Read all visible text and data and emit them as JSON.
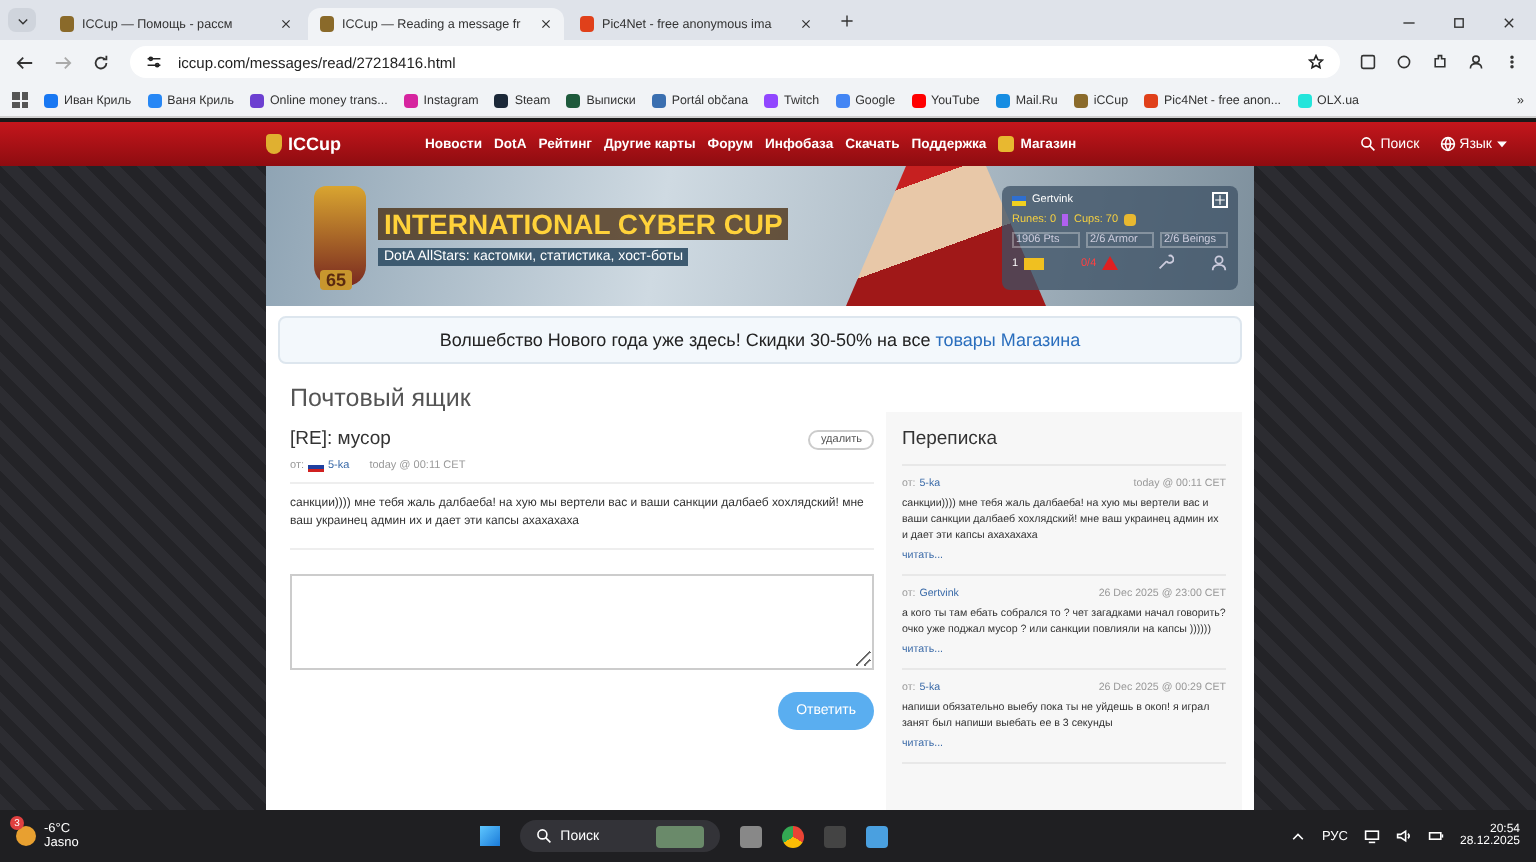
{
  "browser": {
    "tabs": [
      {
        "title": "ICCup — Помощь - рассм",
        "color": "#8a6a2a",
        "selected": false
      },
      {
        "title": "ICCup — Reading a message fr",
        "color": "#8a6a2a",
        "selected": true
      },
      {
        "title": "Pic4Net - free anonymous ima",
        "color": "#e0401a",
        "selected": false
      }
    ],
    "address": "iccup.com/messages/read/27218416.html",
    "bookmarks": [
      {
        "label": "Иван Криль",
        "color": "#1877f2"
      },
      {
        "label": "Ваня Криль",
        "color": "#2787f5"
      },
      {
        "label": "Online money trans...",
        "color": "#6c3fd1"
      },
      {
        "label": "Instagram",
        "color": "#d6249f"
      },
      {
        "label": "Steam",
        "color": "#1b2838"
      },
      {
        "label": "Выписки",
        "color": "#1e5a3c"
      },
      {
        "label": "Portál občana",
        "color": "#3a6fb0"
      },
      {
        "label": "Twitch",
        "color": "#9146ff"
      },
      {
        "label": "Google",
        "color": "#4285f4"
      },
      {
        "label": "YouTube",
        "color": "#ff0000"
      },
      {
        "label": "Mail.Ru",
        "color": "#168de2"
      },
      {
        "label": "iCCup",
        "color": "#8a6a2a"
      },
      {
        "label": "Pic4Net - free anon...",
        "color": "#e0401a"
      },
      {
        "label": "OLX.ua",
        "color": "#23e5db"
      }
    ],
    "more": "»"
  },
  "site": {
    "logo": "ICCup",
    "nav": [
      {
        "label": "Новости",
        "kind": "link"
      },
      {
        "label": "DotA",
        "kind": "link"
      },
      {
        "label": "Рейтинг",
        "kind": "link"
      },
      {
        "label": "Другие карты",
        "kind": "link"
      },
      {
        "label": "Форум",
        "kind": "link"
      },
      {
        "label": "Инфобаза",
        "kind": "link"
      },
      {
        "label": "Скачать",
        "kind": "link"
      },
      {
        "label": "Поддержка",
        "kind": "link"
      },
      {
        "label": "Магазин",
        "kind": "shop"
      }
    ],
    "search": "Поиск",
    "language": "Язык"
  },
  "banner": {
    "title": "INTERNATIONAL CYBER CUP",
    "subtitle": "DotA AllStars: кастомки, статистика, хост-боты",
    "badge": "65"
  },
  "user_panel": {
    "name": "Gertvink",
    "runes": "Runes: 0",
    "cups": "Cups: 70",
    "stats": [
      "1906 Pts",
      "2/6 Armor",
      "2/6 Beings"
    ],
    "mail_count": "1",
    "warnings": "0/4"
  },
  "promo": {
    "text": "Волшебство Нового года уже здесь! Скидки 30-50% на все",
    "link": "товары Магазина"
  },
  "mailbox": {
    "heading": "Почтовый ящик",
    "subject": "[RE]: мусор",
    "delete": "удалить",
    "from_label": "от:",
    "sender": "5-ka",
    "time": "today @ 00:11 CET",
    "body": "санкции)))) мне тебя жаль далбаеба! на хую мы вертели вас и ваши санкции далбаеб хохлядский! мне ваш украинец админ их и дает эти капсы ахахахаха",
    "reply_button": "Ответить"
  },
  "conversation": {
    "heading": "Переписка",
    "messages": [
      {
        "from_label": "от:",
        "sender": "5-ka",
        "time": "today @ 00:11 CET",
        "body": "санкции)))) мне тебя жаль далбаеба! на хую мы вертели вас и ваши санкции далбаеб хохлядский! мне ваш украинец админ их и дает эти капсы ахахахаха",
        "read_more": "читать..."
      },
      {
        "from_label": "от:",
        "sender": "Gertvink",
        "time": "26 Dec 2025 @ 23:00 CET",
        "body": "а кого ты там ебать собрался то ? чет загадками начал говорить? очко уже поджал мусор ? или санкции повлияли на капсы ))))))",
        "read_more": "читать..."
      },
      {
        "from_label": "от:",
        "sender": "5-ka",
        "time": "26 Dec 2025 @ 00:29 CET",
        "body": "напиши обязательно выебу пока ты не уйдешь в окоп! я играл занят был напиши выебать ее в 3 секунды",
        "read_more": "читать..."
      }
    ]
  },
  "taskbar": {
    "temperature": "-6°C",
    "weather": "Jasno",
    "weather_badge": "3",
    "search": "Поиск",
    "language": "РУС",
    "time": "20:54",
    "date": "28.12.2025"
  }
}
